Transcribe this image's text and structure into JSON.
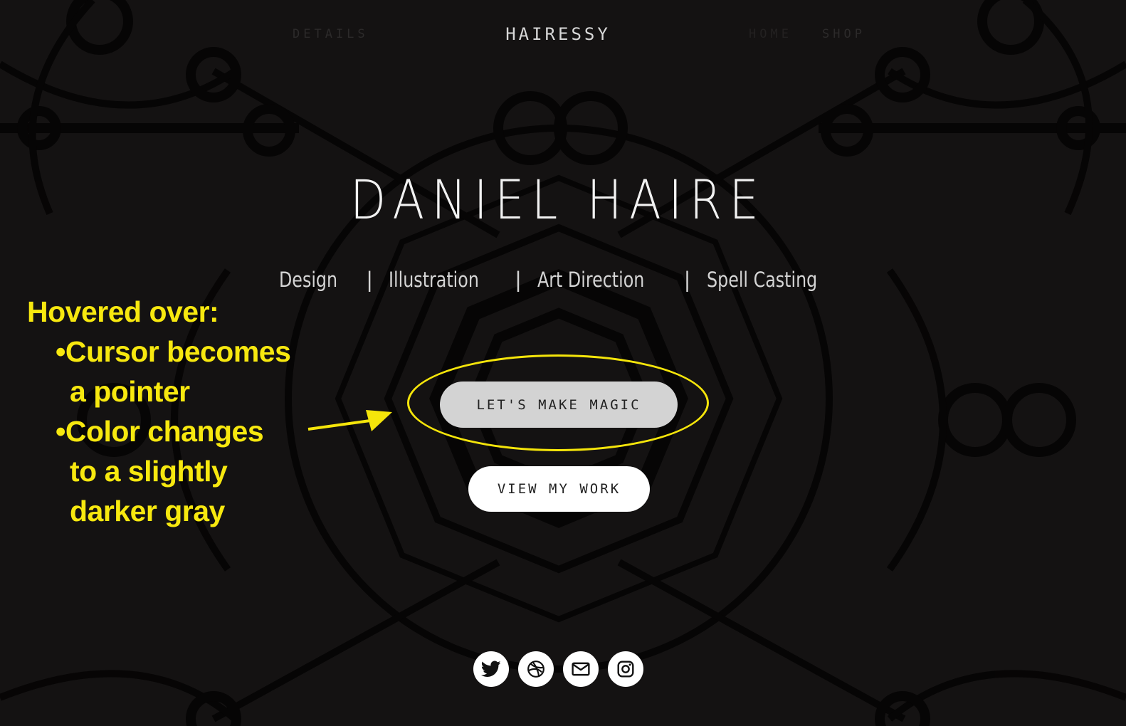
{
  "nav": {
    "brand": "HAIRESSY",
    "details_label": "DETAILS",
    "home_label": "HOME",
    "shop_label": "SHOP"
  },
  "hero": {
    "title": "DANIEL HAIRE",
    "tagline": {
      "items": [
        "Design",
        "Illustration",
        "Art Direction",
        "Spell Casting"
      ],
      "separator": "|"
    }
  },
  "buttons": {
    "primary_label": "LET'S MAKE MAGIC",
    "primary_state": "hovered",
    "secondary_label": "VIEW MY WORK"
  },
  "annotation": {
    "heading": "Hovered over:",
    "lines": [
      "•Cursor becomes",
      "a pointer",
      "•Color changes",
      "to a slightly",
      "darker gray"
    ],
    "color": "#f7e80f"
  },
  "socials": [
    {
      "icon": "twitter-icon"
    },
    {
      "icon": "dribbble-icon"
    },
    {
      "icon": "mail-icon"
    },
    {
      "icon": "instagram-icon"
    }
  ],
  "colors": {
    "background": "#141212",
    "pattern": "#000000",
    "primary_button_hover": "#d3d3d3",
    "secondary_button": "#ffffff"
  }
}
